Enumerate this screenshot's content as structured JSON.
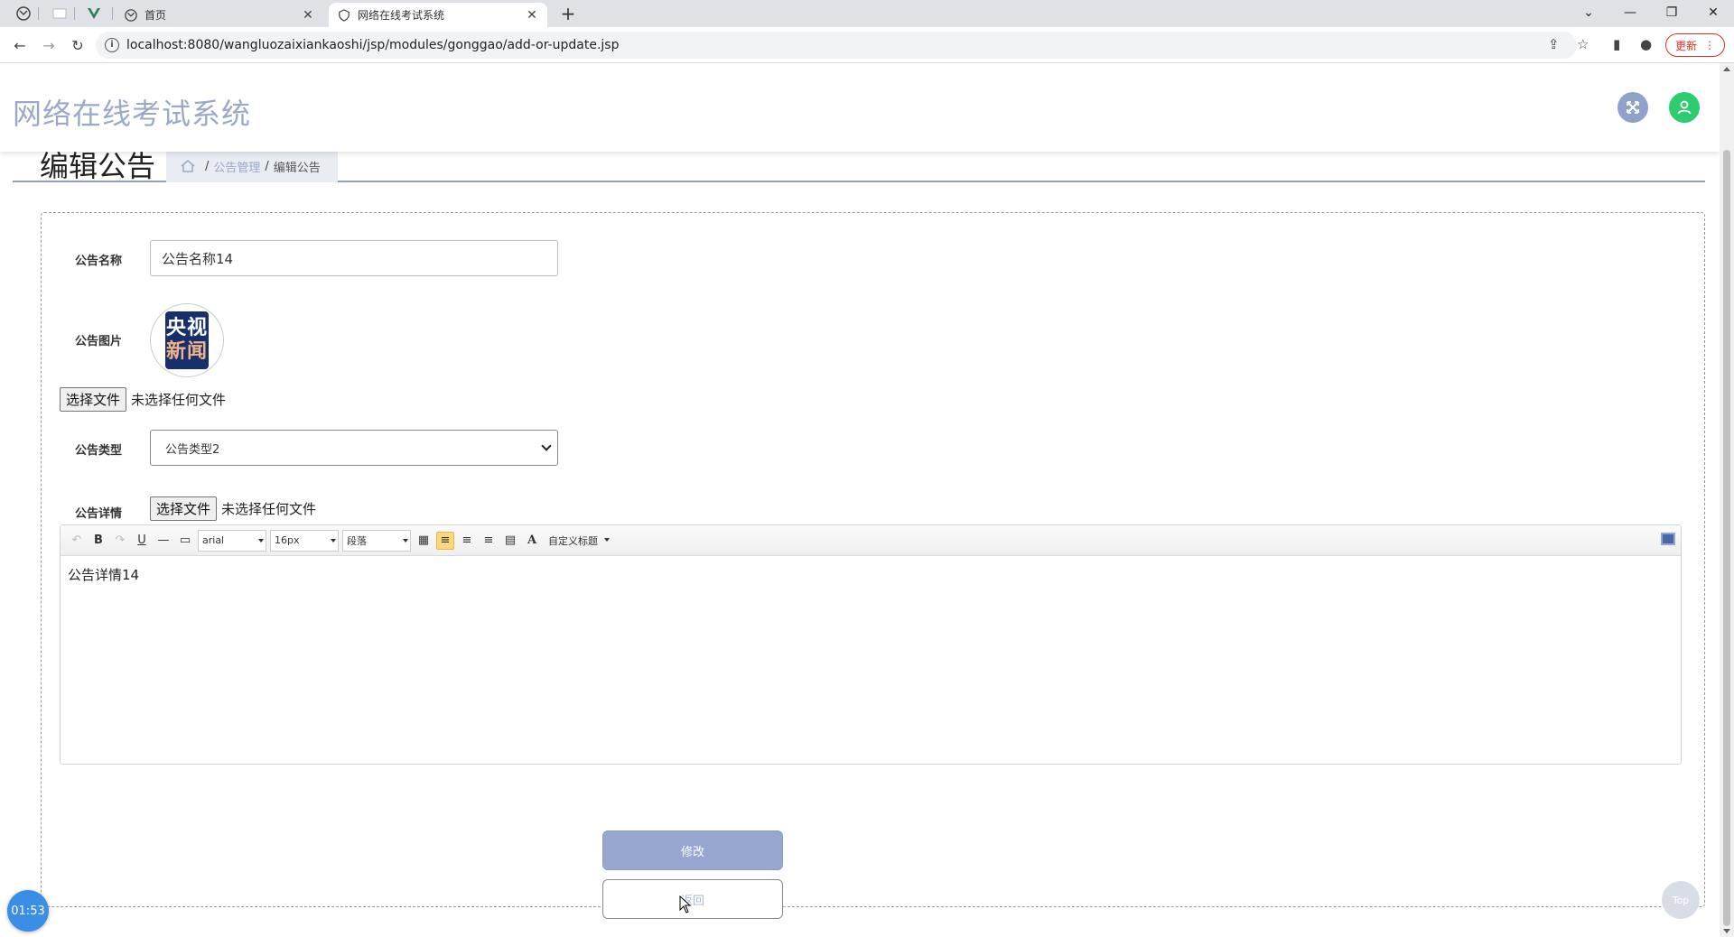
{
  "browser": {
    "tabs": [
      {
        "title": "首页"
      },
      {
        "title": "网络在线考试系统"
      }
    ],
    "address": "localhost:8080/wangluozaixiankaoshi/jsp/modules/gonggao/add-or-update.jsp",
    "update_label": "更新"
  },
  "header": {
    "site_title": "网络在线考试系统"
  },
  "page": {
    "title": "编辑公告",
    "breadcrumb": {
      "separator": "/",
      "section": "公告管理",
      "current": "编辑公告"
    }
  },
  "form": {
    "name_label": "公告名称",
    "name_value": "公告名称14",
    "image_label": "公告图片",
    "image_logo_line1": "央视",
    "image_logo_line2": "新闻",
    "file_button": "选择文件",
    "file_none": "未选择任何文件",
    "type_label": "公告类型",
    "type_value": "公告类型2",
    "detail_label": "公告详情",
    "detail_content": "公告详情14",
    "submit_label": "修改",
    "back_label": "返回"
  },
  "editor_toolbar": {
    "font_family": "arial",
    "font_size": "16px",
    "paragraph": "段落",
    "custom_title": "自定义标题",
    "bold": "B",
    "underline": "U",
    "font_color": "A"
  },
  "widgets": {
    "timer": "01:53",
    "top_label": "Top"
  },
  "colors": {
    "accent": "#97a7cf",
    "site_title": "#9ba9c9",
    "avatar_green": "#2ecc71",
    "timer_blue": "#3a8ee6"
  }
}
